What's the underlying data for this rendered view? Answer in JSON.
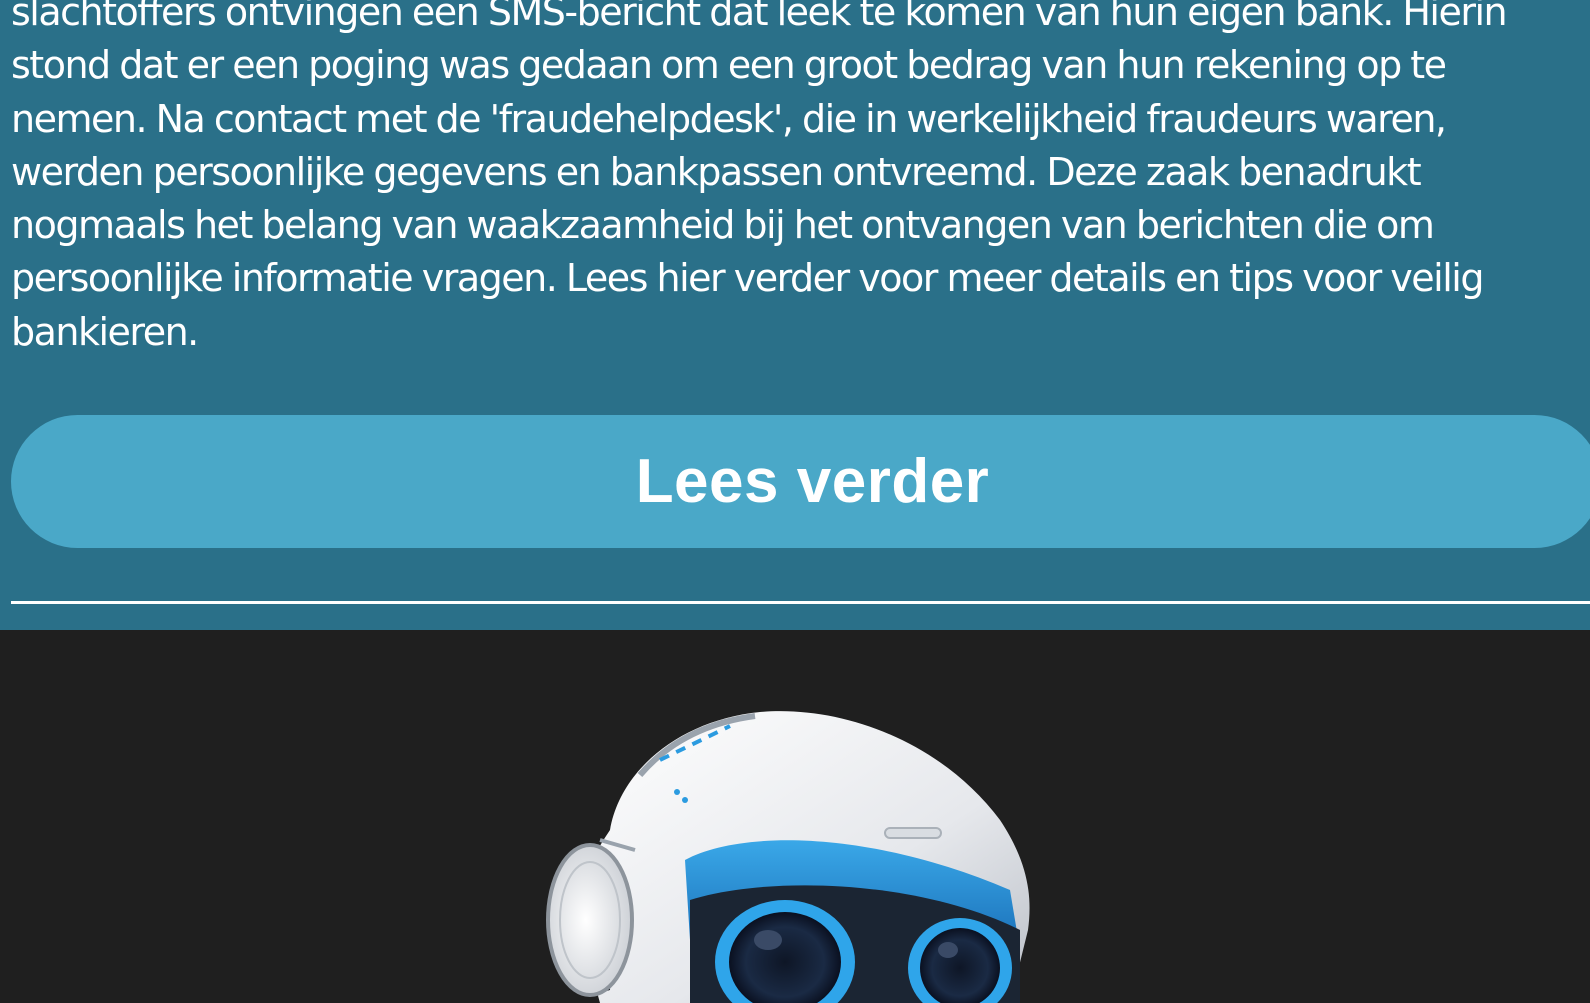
{
  "article": {
    "lines": [
      "slachtoffers ontvingen een SMS-bericht dat leek te komen van hun eigen bank. Hierin",
      "stond dat er een poging was gedaan om een groot bedrag van hun rekening op te",
      "nemen. Na contact met de 'fraudehelpdesk', die in werkelijkheid fraudeurs waren,",
      "werden persoonlijke gegevens en bankpassen ontvreemd. Deze zaak benadrukt",
      "nogmaals het belang van waakzaamheid bij het ontvangen van berichten die om",
      "persoonlijke informatie vragen. Lees hier verder voor meer details en tips voor veilig",
      "bankieren."
    ]
  },
  "read_more": {
    "label": "Lees verder"
  },
  "illustration": {
    "icon": "robot-mascot-icon"
  },
  "colors": {
    "section_background": "#2a7089",
    "button_background": "#4aa8c8",
    "dark_background": "#1f1f1f",
    "text": "#ffffff"
  }
}
